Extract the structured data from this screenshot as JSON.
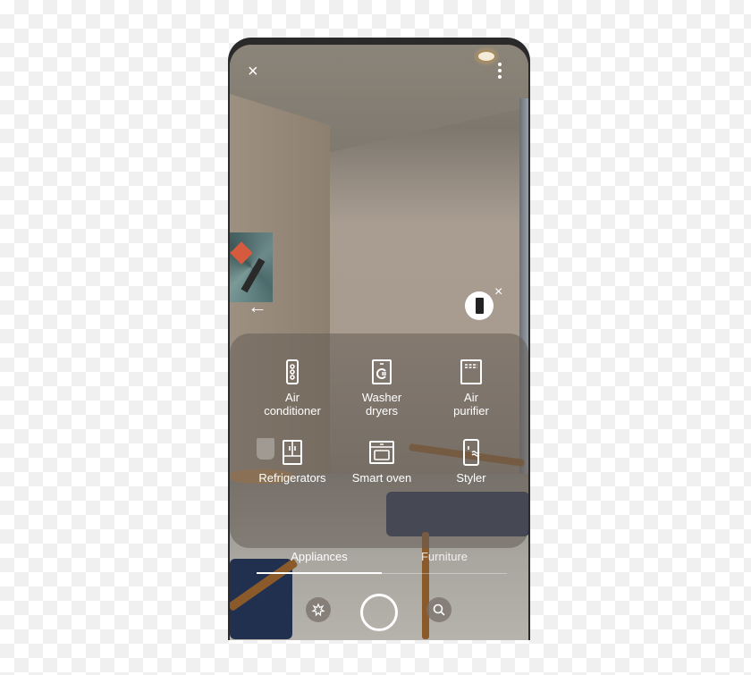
{
  "top_bar": {
    "close_icon": "×",
    "more_icon": "more-vertical"
  },
  "ar_overlay": {
    "back_icon": "←",
    "placed_product": "refrigerator",
    "remove_icon": "×"
  },
  "categories": [
    {
      "label": "Air\nconditioner",
      "icon": "air-conditioner-icon"
    },
    {
      "label": "Washer\ndryers",
      "icon": "washer-icon"
    },
    {
      "label": "Air\npurifier",
      "icon": "air-purifier-icon"
    },
    {
      "label": "Refrigerators",
      "icon": "refrigerator-icon"
    },
    {
      "label": "Smart oven",
      "icon": "oven-icon"
    },
    {
      "label": "Styler",
      "icon": "styler-icon"
    }
  ],
  "tabs": [
    {
      "label": "Appliances",
      "active": true
    },
    {
      "label": "Furniture",
      "active": false
    }
  ],
  "bottom_bar": {
    "left_icon": "flower-icon",
    "center": "shutter",
    "right_icon": "search-icon"
  }
}
